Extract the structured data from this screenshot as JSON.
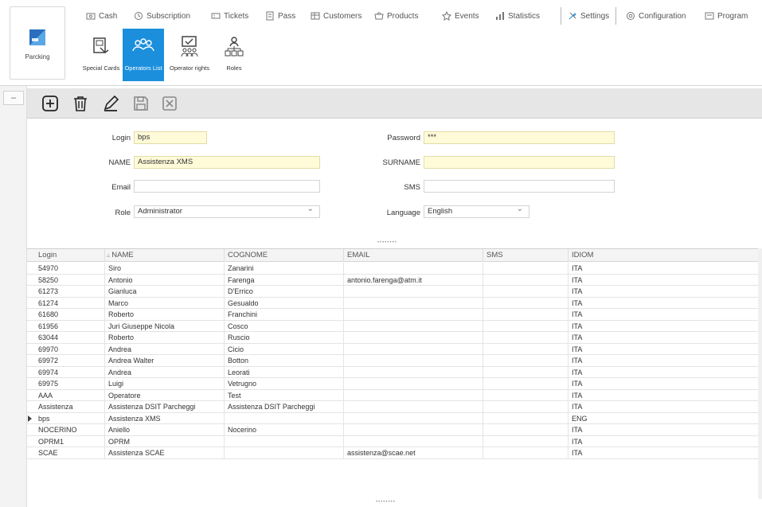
{
  "app": {
    "label": "Parcking"
  },
  "tabs": [
    {
      "label": "Cash",
      "icon": "cash-icon"
    },
    {
      "label": "Subscription",
      "icon": "subscription-icon"
    },
    {
      "label": "Tickets",
      "icon": "tickets-icon"
    },
    {
      "label": "Pass",
      "icon": "pass-icon"
    },
    {
      "label": "Customers",
      "icon": "customers-icon"
    },
    {
      "label": "Products",
      "icon": "products-icon"
    },
    {
      "label": "Events",
      "icon": "events-icon"
    },
    {
      "label": "Statistics",
      "icon": "statistics-icon"
    },
    {
      "label": "Settings",
      "icon": "settings-icon",
      "active": true
    },
    {
      "label": "Configuration",
      "icon": "configuration-icon"
    },
    {
      "label": "Program",
      "icon": "program-icon"
    }
  ],
  "ribbon": [
    {
      "label": "Special Cards",
      "icon": "special-cards-icon"
    },
    {
      "label": "Operators List",
      "icon": "operators-list-icon",
      "active": true
    },
    {
      "label": "Operator rights",
      "icon": "operator-rights-icon"
    },
    {
      "label": "Roles",
      "icon": "roles-icon"
    }
  ],
  "toolbar": {
    "add": "add-icon",
    "delete": "trash-icon",
    "edit": "pencil-icon",
    "save": "save-icon",
    "cancel": "cancel-icon"
  },
  "form": {
    "login_label": "Login",
    "login_value": "bps",
    "password_label": "Password",
    "password_value": "***",
    "name_label": "NAME",
    "name_value": "Assistenza XMS",
    "surname_label": "SURNAME",
    "surname_value": "",
    "email_label": "Email",
    "email_value": "",
    "sms_label": "SMS",
    "sms_value": "",
    "role_label": "Role",
    "role_value": "Administrator",
    "language_label": "Language",
    "language_value": "English"
  },
  "colors": {
    "accent": "#1b8fdc",
    "required_field": "#fffbd9"
  },
  "grid": {
    "columns": [
      "Login",
      "NAME",
      "COGNOME",
      "EMAIL",
      "SMS",
      "IDIOM"
    ],
    "rows": [
      [
        "54970",
        "Siro",
        "Zanarini",
        "",
        "",
        "ITA"
      ],
      [
        "58250",
        "Antonio",
        "Farenga",
        "antonio.farenga@atm.it",
        "",
        "ITA"
      ],
      [
        "61273",
        "Gianluca",
        "D'Errico",
        "",
        "",
        "ITA"
      ],
      [
        "61274",
        "Marco",
        "Gesualdo",
        "",
        "",
        "ITA"
      ],
      [
        "61680",
        "Roberto",
        "Franchini",
        "",
        "",
        "ITA"
      ],
      [
        "61956",
        "Juri Giuseppe Nicola",
        "Cosco",
        "",
        "",
        "ITA"
      ],
      [
        "63044",
        "Roberto",
        "Ruscio",
        "",
        "",
        "ITA"
      ],
      [
        "69970",
        "Andrea",
        "Cicio",
        "",
        "",
        "ITA"
      ],
      [
        "69972",
        "Andrea Walter",
        "Botton",
        "",
        "",
        "ITA"
      ],
      [
        "69974",
        "Andrea",
        "Leorati",
        "",
        "",
        "ITA"
      ],
      [
        "69975",
        "Luigi",
        "Vetrugno",
        "",
        "",
        "ITA"
      ],
      [
        "AAA",
        "Operatore",
        "Test",
        "",
        "",
        "ITA"
      ],
      [
        "Assistenza",
        "Assistenza DSIT Parcheggi",
        "Assistenza DSIT Parcheggi",
        "",
        "",
        "ITA"
      ],
      [
        "bps",
        "Assistenza XMS",
        "",
        "",
        "",
        "ENG"
      ],
      [
        "NOCERINO",
        "Aniello",
        "Nocerino",
        "",
        "",
        "ITA"
      ],
      [
        "OPRM1",
        "OPRM",
        "",
        "",
        "",
        "ITA"
      ],
      [
        "SCAE",
        "Assistenza SCAE",
        "",
        "assistenza@scae.net",
        "",
        "ITA"
      ]
    ],
    "selected_row": 13
  }
}
